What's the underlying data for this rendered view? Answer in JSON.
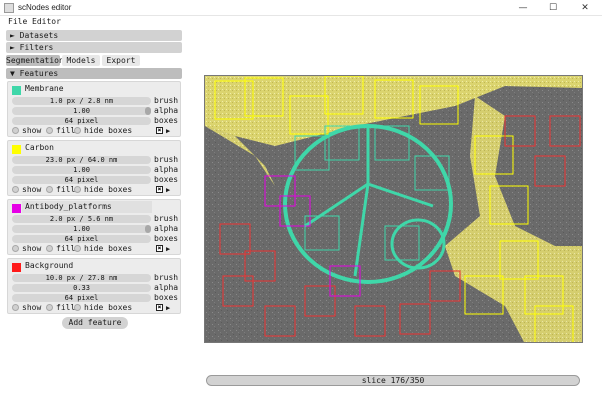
{
  "window": {
    "title": "scNodes editor",
    "minimize": "—",
    "maximize": "☐",
    "close": "✕"
  },
  "menu": {
    "file": "File",
    "editor": "Editor"
  },
  "panels": {
    "datasets": "► Datasets",
    "filters": "► Filters"
  },
  "tabs": {
    "segmentation": "Segmentation",
    "models": "Models",
    "export": "Export"
  },
  "features_header": "▼ Features",
  "features": [
    {
      "name": "Membrane",
      "color": "#3fd7a9",
      "brush": "1.0 px / 2.8 nm",
      "alpha": "1.00",
      "boxes": "64 pixel",
      "brush_label": "brush",
      "alpha_label": "alpha",
      "boxes_label": "boxes",
      "show": "show",
      "fill": "fill",
      "hide_boxes": "hide boxes",
      "x_mark": "✖",
      "arrow": "▶"
    },
    {
      "name": "Carbon",
      "color": "#ffff00",
      "brush": "23.0 px / 64.0 nm",
      "alpha": "1.00",
      "boxes": "64 pixel",
      "brush_label": "brush",
      "alpha_label": "alpha",
      "boxes_label": "boxes",
      "show": "show",
      "fill": "fill",
      "hide_boxes": "hide boxes",
      "x_mark": "✖",
      "arrow": "▶"
    },
    {
      "name": "Antibody_platforms",
      "color": "#e600e6",
      "brush": "2.0 px / 5.6 nm",
      "alpha": "1.00",
      "boxes": "64 pixel",
      "brush_label": "brush",
      "alpha_label": "alpha",
      "boxes_label": "boxes",
      "show": "show",
      "fill": "fill",
      "hide_boxes": "hide boxes",
      "x_mark": "✖",
      "arrow": "▶"
    },
    {
      "name": "Background",
      "color": "#ff1a1a",
      "brush": "10.0 px / 27.8 nm",
      "alpha": "0.33",
      "boxes": "64 pixel",
      "brush_label": "brush",
      "alpha_label": "alpha",
      "boxes_label": "boxes",
      "show": "show",
      "fill": "fill",
      "hide_boxes": "hide boxes",
      "x_mark": "✖",
      "arrow": "▶"
    }
  ],
  "add_feature": "Add feature",
  "slice": {
    "label": "slice 176/350",
    "current": 176,
    "total": 350
  }
}
